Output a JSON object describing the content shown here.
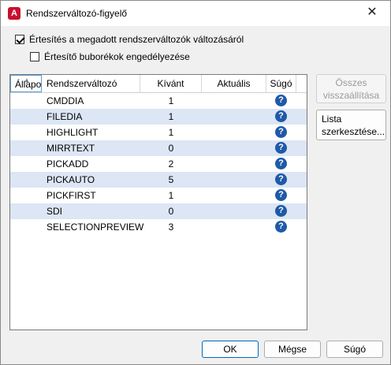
{
  "window": {
    "title": "Rendszerváltozó-figyelő",
    "app_icon_letter": "A",
    "close_glyph": "✕"
  },
  "options": {
    "notify_label": "Értesítés a megadott rendszerváltozók változásáról",
    "notify_checked": true,
    "balloon_label": "Értesítő buborékok engedélyezése",
    "balloon_checked": false
  },
  "table": {
    "columns": [
      "Állapot",
      "Rendszerváltozó",
      "Kívánt",
      "Aktuális",
      "Súgó"
    ],
    "rows": [
      {
        "name": "CMDDIA",
        "desired": "1",
        "current": ""
      },
      {
        "name": "FILEDIA",
        "desired": "1",
        "current": ""
      },
      {
        "name": "HIGHLIGHT",
        "desired": "1",
        "current": ""
      },
      {
        "name": "MIRRTEXT",
        "desired": "0",
        "current": ""
      },
      {
        "name": "PICKADD",
        "desired": "2",
        "current": ""
      },
      {
        "name": "PICKAUTO",
        "desired": "5",
        "current": ""
      },
      {
        "name": "PICKFIRST",
        "desired": "1",
        "current": ""
      },
      {
        "name": "SDI",
        "desired": "0",
        "current": ""
      },
      {
        "name": "SELECTIONPREVIEW",
        "desired": "3",
        "current": ""
      }
    ],
    "help_glyph": "?"
  },
  "side_buttons": {
    "reset_all": "Összes\nvisszaállítása",
    "edit_list": "Lista\nszerkesztése..."
  },
  "footer": {
    "ok": "OK",
    "cancel": "Mégse",
    "help": "Súgó"
  },
  "colors": {
    "row_alt": "#dce6f4",
    "help_icon": "#1f5aa6",
    "app_icon": "#c8102e"
  }
}
